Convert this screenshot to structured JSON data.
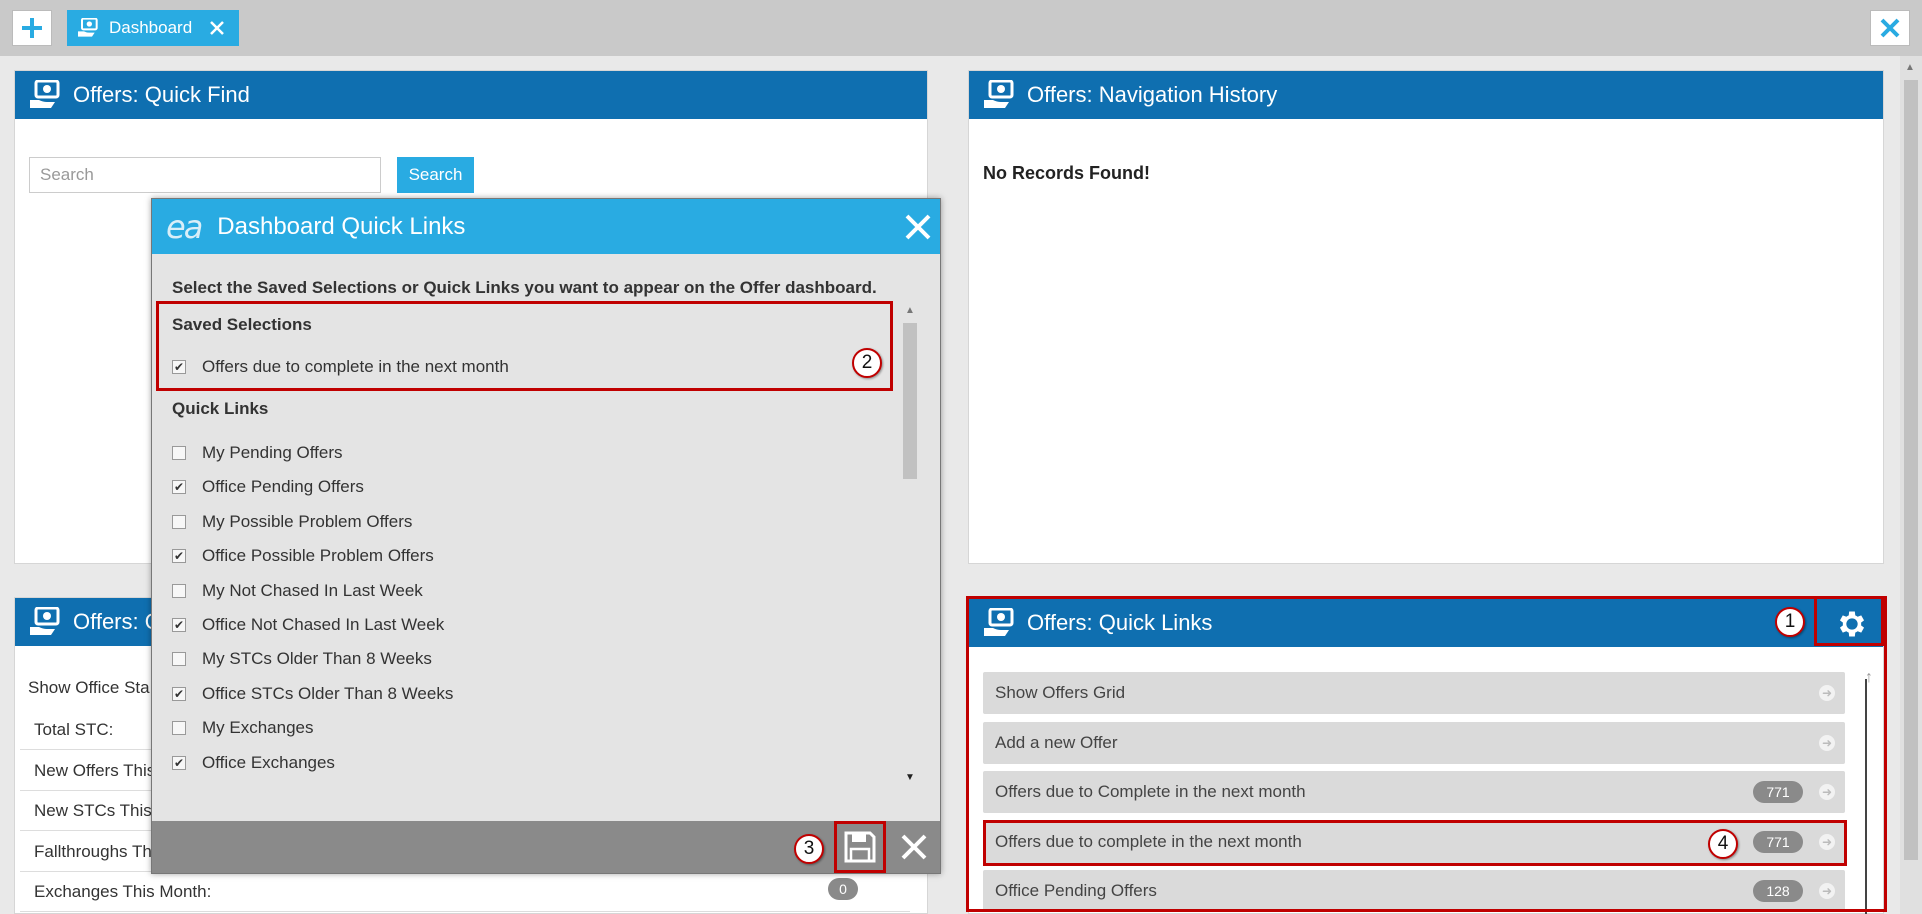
{
  "topbar": {
    "tab_label": "Dashboard",
    "colors": {
      "tab": "#29abe2",
      "bar": "#c9c9c9"
    }
  },
  "quick_find": {
    "title": "Offers: Quick Find",
    "search_placeholder": "Search",
    "search_button": "Search"
  },
  "nav_history": {
    "title": "Offers: Navigation History",
    "empty_text": "No Records Found!"
  },
  "stats": {
    "title": "Offers: Q",
    "show_office": "Show Office Sta",
    "rows": [
      {
        "label": "Total STC:"
      },
      {
        "label": "New Offers This"
      },
      {
        "label": "New STCs This"
      },
      {
        "label": "Fallthroughs Th"
      },
      {
        "label": "Exchanges This Month:",
        "count": "0"
      }
    ]
  },
  "quick_links": {
    "title": "Offers: Quick Links",
    "items": [
      {
        "label": "Show Offers Grid",
        "count": ""
      },
      {
        "label": "Add a new Offer",
        "count": ""
      },
      {
        "label": "Offers due to Complete in the next month",
        "count": "771"
      },
      {
        "label": "Offers due to complete in the next month",
        "count": "771"
      },
      {
        "label": "Office Pending Offers",
        "count": "128"
      }
    ]
  },
  "modal": {
    "title": "Dashboard Quick Links",
    "logo": "ea",
    "intro": "Select the Saved Selections or Quick Links you want to appear on the Offer dashboard.",
    "saved_heading": "Saved Selections",
    "saved": [
      {
        "label": "Offers due to complete in the next month",
        "checked": true
      }
    ],
    "links_heading": "Quick Links",
    "links": [
      {
        "label": "My Pending Offers",
        "checked": false
      },
      {
        "label": "Office Pending Offers",
        "checked": true
      },
      {
        "label": "My Possible Problem Offers",
        "checked": false
      },
      {
        "label": "Office Possible Problem Offers",
        "checked": true
      },
      {
        "label": "My Not Chased In Last Week",
        "checked": false
      },
      {
        "label": "Office Not Chased In Last Week",
        "checked": true
      },
      {
        "label": "My STCs Older Than 8 Weeks",
        "checked": false
      },
      {
        "label": "Office STCs Older Than 8 Weeks",
        "checked": true
      },
      {
        "label": "My Exchanges",
        "checked": false
      },
      {
        "label": "Office Exchanges",
        "checked": true
      }
    ]
  },
  "markers": [
    "1",
    "2",
    "3",
    "4"
  ],
  "colors": {
    "panel_header": "#0f6fb0",
    "accent": "#29abe2",
    "highlight": "#c00000",
    "footer": "#8a8a8a"
  }
}
